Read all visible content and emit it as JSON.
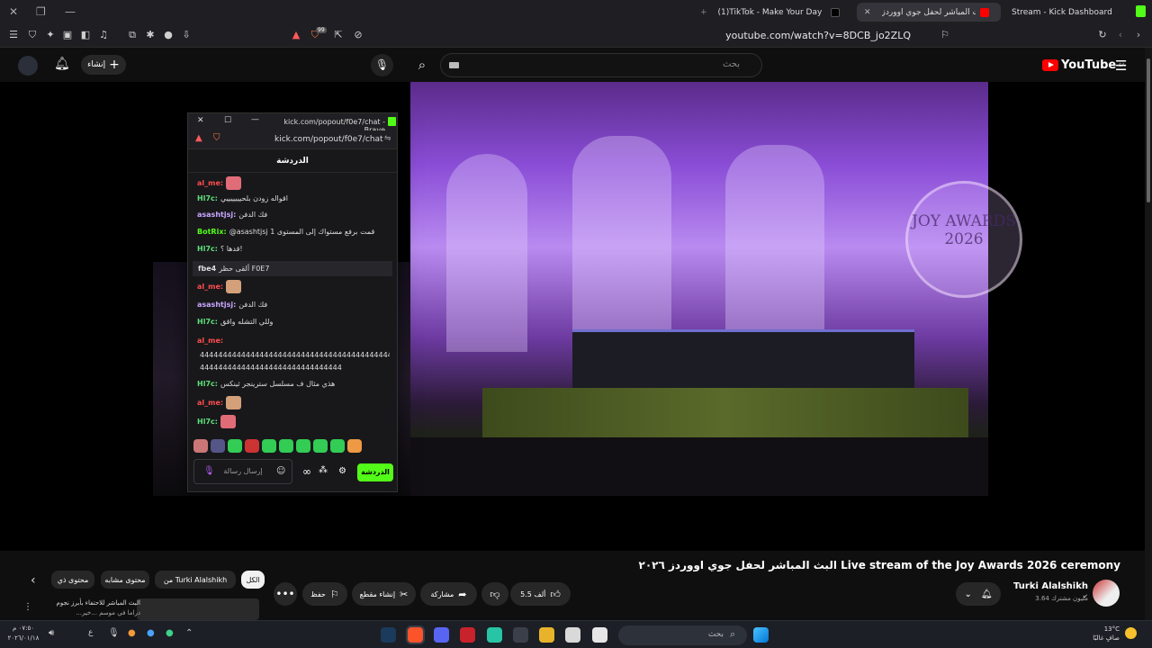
{
  "browser": {
    "tabs": [
      {
        "label": "Stream - Kick Dashboard",
        "active": false
      },
      {
        "label": "البث المباشر لحفل جوي اووردز",
        "active": true
      },
      {
        "label": "(1)TikTok - Make Your Day",
        "active": false
      }
    ],
    "url": "youtube.com/watch?v=8DCB_jo2ZLQ",
    "shield_badge": "99"
  },
  "youtube": {
    "logo_text": "YouTube",
    "region": "SA",
    "search_placeholder": "بحث",
    "create_label": "إنشاء",
    "video_title": "البث المباشر لحفل جوي اووردز ٢٠٢٦ Live stream of the Joy Awards 2026 ceremony",
    "channel_name": "Turki Alalshikh",
    "subscribers": "3.64 مليون مشترك",
    "likes": "5.5 ألف",
    "share_label": "مشاركة",
    "clip_label": "إنشاء مقطع",
    "save_label": "حفظ",
    "chips": [
      "الكل",
      "من Turki Alalshikh",
      "محتوى مشابه",
      "محتوى ذي"
    ],
    "rec_title": "البث المباشر للاحتفاء بأبرز نجوم",
    "rec_sub": "...دراما في موسم ...خير",
    "stage_text_1": "JOY AWARDS",
    "stage_text_2": "2026"
  },
  "chat": {
    "window_title": "kick.com/popout/f0e7/chat - Brave",
    "address": "kick.com/popout/f0e7/chat",
    "header": "الدردشة",
    "input_placeholder": "إرسال رسالة",
    "send_label": "الدردشة",
    "messages": [
      {
        "user": "al_me:",
        "text": "",
        "color": "#ff4d4d",
        "emote": "#e06c78"
      },
      {
        "user": "Hl7c:",
        "text": "اقواله زودن بلحيييييييي",
        "color": "#5ee07a",
        "emote": ""
      },
      {
        "user": "asashtjsj:",
        "text": "فك الدفن",
        "color": "#c9a7ff",
        "emote": ""
      },
      {
        "user": "BotRix:",
        "text": "@asashtjsj قمت برفع مستواك إلى المستوى 1",
        "color": "#53fc18",
        "emote": ""
      },
      {
        "user": "Hl7c:",
        "text": "قدها ؟!",
        "color": "#5ee07a",
        "emote": ""
      },
      {
        "user": "fbe4",
        "text": "ألقى حظر F0E7",
        "color": "#dddddd",
        "emote": ""
      },
      {
        "user": "al_me:",
        "text": "",
        "color": "#ff4d4d",
        "emote": "#d4a07a"
      },
      {
        "user": "asashtjsj:",
        "text": "فك الدفن",
        "color": "#c9a7ff",
        "emote": ""
      },
      {
        "user": "Hl7c:",
        "text": "وللي التشله واقق",
        "color": "#5ee07a",
        "emote": ""
      },
      {
        "user": "al_me:",
        "text": "",
        "color": "#ff4d4d",
        "emote": ""
      },
      {
        "user": "",
        "text": "444444444444444444444444444444444444444444444444",
        "color": "#ff4d4d",
        "emote": ""
      },
      {
        "user": "",
        "text": "4444444444444444444444444444444",
        "color": "#ff4d4d",
        "emote": ""
      },
      {
        "user": "Hl7c:",
        "text": "هذي مثال ف مسلسل سترينجر ثينكس",
        "color": "#5ee07a",
        "emote": ""
      },
      {
        "user": "al_me:",
        "text": "",
        "color": "#ff4d4d",
        "emote": "#d4a07a"
      },
      {
        "user": "Hl7c:",
        "text": "",
        "color": "#5ee07a",
        "emote": "#e06c78"
      }
    ]
  },
  "taskbar": {
    "search_placeholder": "بحث",
    "time": "٠٧:٥٠ م",
    "date": "٢٠٢٦/٠١/١٨",
    "weather_temp": "13°C",
    "weather_desc": "صافٍ غالبًا"
  }
}
